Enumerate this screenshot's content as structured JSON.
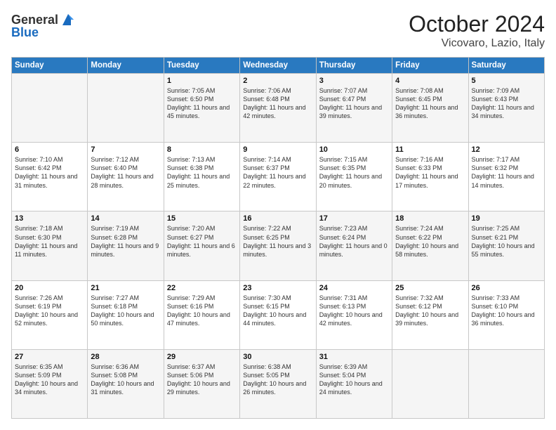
{
  "header": {
    "logo_general": "General",
    "logo_blue": "Blue",
    "month": "October 2024",
    "location": "Vicovaro, Lazio, Italy"
  },
  "weekdays": [
    "Sunday",
    "Monday",
    "Tuesday",
    "Wednesday",
    "Thursday",
    "Friday",
    "Saturday"
  ],
  "weeks": [
    [
      {
        "day": "",
        "info": ""
      },
      {
        "day": "",
        "info": ""
      },
      {
        "day": "1",
        "info": "Sunrise: 7:05 AM\nSunset: 6:50 PM\nDaylight: 11 hours and 45 minutes."
      },
      {
        "day": "2",
        "info": "Sunrise: 7:06 AM\nSunset: 6:48 PM\nDaylight: 11 hours and 42 minutes."
      },
      {
        "day": "3",
        "info": "Sunrise: 7:07 AM\nSunset: 6:47 PM\nDaylight: 11 hours and 39 minutes."
      },
      {
        "day": "4",
        "info": "Sunrise: 7:08 AM\nSunset: 6:45 PM\nDaylight: 11 hours and 36 minutes."
      },
      {
        "day": "5",
        "info": "Sunrise: 7:09 AM\nSunset: 6:43 PM\nDaylight: 11 hours and 34 minutes."
      }
    ],
    [
      {
        "day": "6",
        "info": "Sunrise: 7:10 AM\nSunset: 6:42 PM\nDaylight: 11 hours and 31 minutes."
      },
      {
        "day": "7",
        "info": "Sunrise: 7:12 AM\nSunset: 6:40 PM\nDaylight: 11 hours and 28 minutes."
      },
      {
        "day": "8",
        "info": "Sunrise: 7:13 AM\nSunset: 6:38 PM\nDaylight: 11 hours and 25 minutes."
      },
      {
        "day": "9",
        "info": "Sunrise: 7:14 AM\nSunset: 6:37 PM\nDaylight: 11 hours and 22 minutes."
      },
      {
        "day": "10",
        "info": "Sunrise: 7:15 AM\nSunset: 6:35 PM\nDaylight: 11 hours and 20 minutes."
      },
      {
        "day": "11",
        "info": "Sunrise: 7:16 AM\nSunset: 6:33 PM\nDaylight: 11 hours and 17 minutes."
      },
      {
        "day": "12",
        "info": "Sunrise: 7:17 AM\nSunset: 6:32 PM\nDaylight: 11 hours and 14 minutes."
      }
    ],
    [
      {
        "day": "13",
        "info": "Sunrise: 7:18 AM\nSunset: 6:30 PM\nDaylight: 11 hours and 11 minutes."
      },
      {
        "day": "14",
        "info": "Sunrise: 7:19 AM\nSunset: 6:28 PM\nDaylight: 11 hours and 9 minutes."
      },
      {
        "day": "15",
        "info": "Sunrise: 7:20 AM\nSunset: 6:27 PM\nDaylight: 11 hours and 6 minutes."
      },
      {
        "day": "16",
        "info": "Sunrise: 7:22 AM\nSunset: 6:25 PM\nDaylight: 11 hours and 3 minutes."
      },
      {
        "day": "17",
        "info": "Sunrise: 7:23 AM\nSunset: 6:24 PM\nDaylight: 11 hours and 0 minutes."
      },
      {
        "day": "18",
        "info": "Sunrise: 7:24 AM\nSunset: 6:22 PM\nDaylight: 10 hours and 58 minutes."
      },
      {
        "day": "19",
        "info": "Sunrise: 7:25 AM\nSunset: 6:21 PM\nDaylight: 10 hours and 55 minutes."
      }
    ],
    [
      {
        "day": "20",
        "info": "Sunrise: 7:26 AM\nSunset: 6:19 PM\nDaylight: 10 hours and 52 minutes."
      },
      {
        "day": "21",
        "info": "Sunrise: 7:27 AM\nSunset: 6:18 PM\nDaylight: 10 hours and 50 minutes."
      },
      {
        "day": "22",
        "info": "Sunrise: 7:29 AM\nSunset: 6:16 PM\nDaylight: 10 hours and 47 minutes."
      },
      {
        "day": "23",
        "info": "Sunrise: 7:30 AM\nSunset: 6:15 PM\nDaylight: 10 hours and 44 minutes."
      },
      {
        "day": "24",
        "info": "Sunrise: 7:31 AM\nSunset: 6:13 PM\nDaylight: 10 hours and 42 minutes."
      },
      {
        "day": "25",
        "info": "Sunrise: 7:32 AM\nSunset: 6:12 PM\nDaylight: 10 hours and 39 minutes."
      },
      {
        "day": "26",
        "info": "Sunrise: 7:33 AM\nSunset: 6:10 PM\nDaylight: 10 hours and 36 minutes."
      }
    ],
    [
      {
        "day": "27",
        "info": "Sunrise: 6:35 AM\nSunset: 5:09 PM\nDaylight: 10 hours and 34 minutes."
      },
      {
        "day": "28",
        "info": "Sunrise: 6:36 AM\nSunset: 5:08 PM\nDaylight: 10 hours and 31 minutes."
      },
      {
        "day": "29",
        "info": "Sunrise: 6:37 AM\nSunset: 5:06 PM\nDaylight: 10 hours and 29 minutes."
      },
      {
        "day": "30",
        "info": "Sunrise: 6:38 AM\nSunset: 5:05 PM\nDaylight: 10 hours and 26 minutes."
      },
      {
        "day": "31",
        "info": "Sunrise: 6:39 AM\nSunset: 5:04 PM\nDaylight: 10 hours and 24 minutes."
      },
      {
        "day": "",
        "info": ""
      },
      {
        "day": "",
        "info": ""
      }
    ]
  ]
}
